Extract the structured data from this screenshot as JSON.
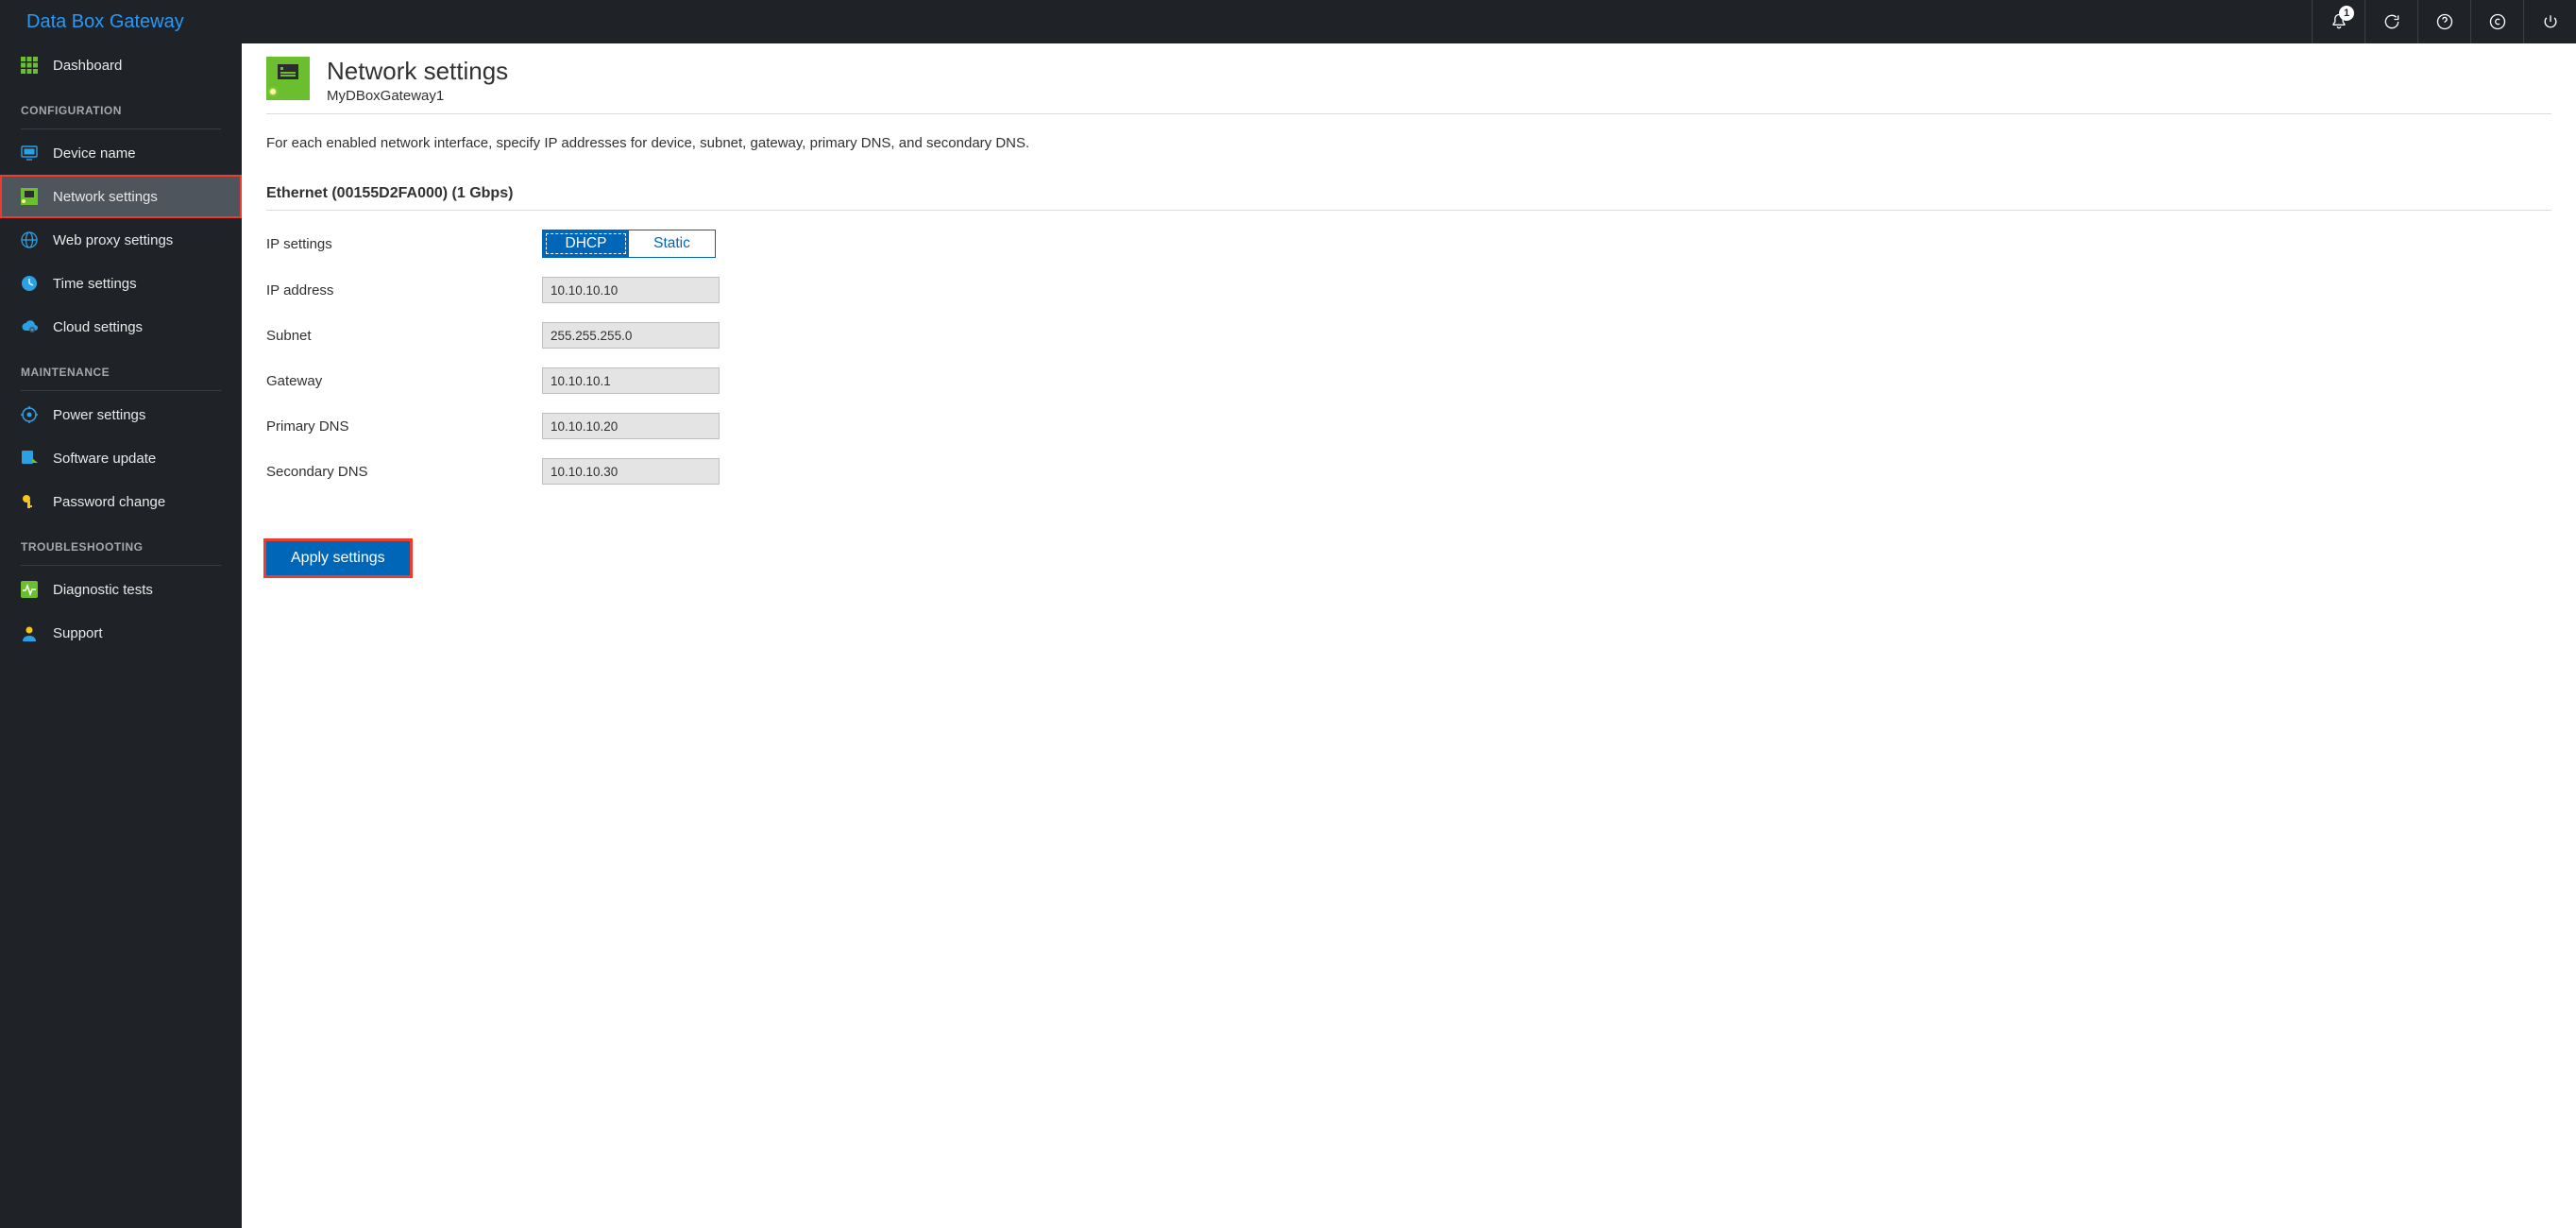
{
  "brand": "Data Box Gateway",
  "topbar": {
    "notification_count": "1"
  },
  "sidebar": {
    "dashboard": "Dashboard",
    "sections": {
      "configuration": "CONFIGURATION",
      "maintenance": "MAINTENANCE",
      "troubleshooting": "TROUBLESHOOTING"
    },
    "items": {
      "device_name": "Device name",
      "network_settings": "Network settings",
      "web_proxy_settings": "Web proxy settings",
      "time_settings": "Time settings",
      "cloud_settings": "Cloud settings",
      "power_settings": "Power settings",
      "software_update": "Software update",
      "password_change": "Password change",
      "diagnostic_tests": "Diagnostic tests",
      "support": "Support"
    }
  },
  "page": {
    "title": "Network settings",
    "subtitle": "MyDBoxGateway1",
    "intro": "For each enabled network interface, specify IP addresses for device, subnet, gateway, primary DNS, and secondary DNS."
  },
  "section": {
    "heading": "Ethernet (00155D2FA000) (1 Gbps)"
  },
  "form": {
    "labels": {
      "ip_settings": "IP settings",
      "ip_address": "IP address",
      "subnet": "Subnet",
      "gateway": "Gateway",
      "primary_dns": "Primary DNS",
      "secondary_dns": "Secondary DNS"
    },
    "toggle": {
      "dhcp": "DHCP",
      "static": "Static"
    },
    "values": {
      "ip_address": "10.10.10.10",
      "subnet": "255.255.255.0",
      "gateway": "10.10.10.1",
      "primary_dns": "10.10.10.20",
      "secondary_dns": "10.10.10.30"
    },
    "apply": "Apply settings"
  }
}
